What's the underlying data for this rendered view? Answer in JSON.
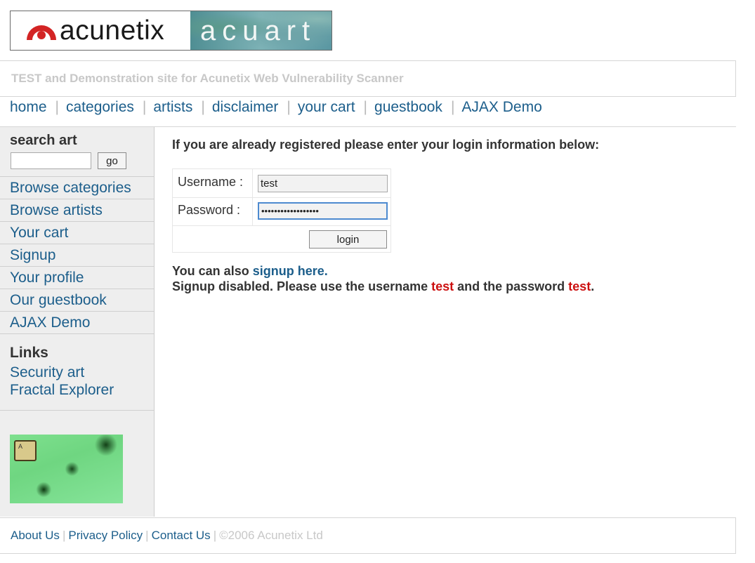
{
  "logo": {
    "brand": "acunetix",
    "site": "acuart"
  },
  "tagline": "TEST and Demonstration site for Acunetix Web Vulnerability Scanner",
  "topnav": [
    "home",
    "categories",
    "artists",
    "disclaimer",
    "your cart",
    "guestbook",
    "AJAX Demo"
  ],
  "sidebar": {
    "search_title": "search art",
    "search_value": "",
    "go_label": "go",
    "menu": [
      "Browse categories",
      "Browse artists",
      "Your cart",
      "Signup",
      "Your profile",
      "Our guestbook",
      "AJAX Demo"
    ],
    "links_title": "Links",
    "links": [
      "Security art",
      "Fractal Explorer"
    ],
    "art_key_label": "A"
  },
  "main": {
    "intro": "If you are already registered please enter your login information below:",
    "username_label": "Username :",
    "username_value": "test",
    "password_label": "Password :",
    "password_value": "••••••••••••••••••",
    "login_label": "login",
    "also_text": "You can also ",
    "signup_link": "signup here.",
    "disabled_prefix": "Signup disabled. Please use the username ",
    "disabled_user": "test",
    "disabled_mid": " and the password ",
    "disabled_pass": "test",
    "disabled_end": "."
  },
  "footer": {
    "links": [
      "About Us",
      "Privacy Policy",
      "Contact Us"
    ],
    "copyright": "©2006 Acunetix Ltd"
  },
  "colors": {
    "link": "#1c5e8b",
    "accent_red": "#cc1111",
    "sidebar_bg": "#eeeeee",
    "logo_red": "#d32424"
  }
}
